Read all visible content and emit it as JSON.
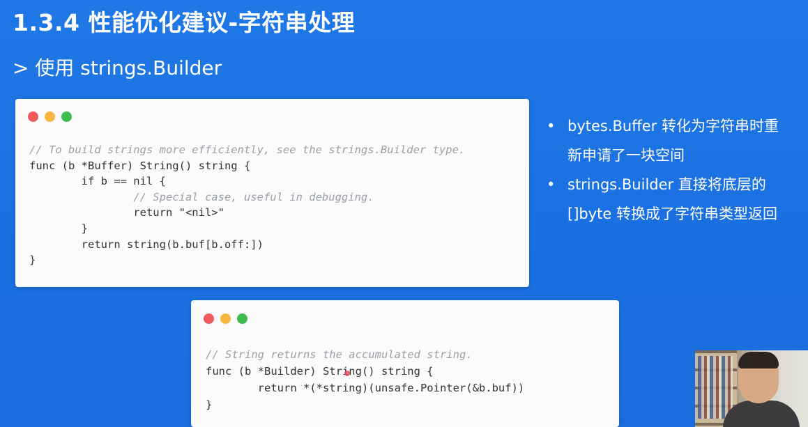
{
  "slide": {
    "title": "1.3.4 性能优化建议-字符串处理",
    "subtitle": "> 使用 strings.Builder"
  },
  "code1": {
    "lines": [
      "// To build strings more efficiently, see the strings.Builder type.",
      "func (b *Buffer) String() string {",
      "        if b == nil {",
      "                // Special case, useful in debugging.",
      "                return \"<nil>\"",
      "        }",
      "        return string(b.buf[b.off:])",
      "}"
    ]
  },
  "code2": {
    "lines": [
      "// String returns the accumulated string.",
      "func (b *Builder) String() string {",
      "        return *(*string)(unsafe.Pointer(&b.buf))",
      "}"
    ]
  },
  "bullets": [
    {
      "line1": "bytes.Buffer 转化为字符串时重",
      "line2": "新申请了一块空间"
    },
    {
      "line1": "strings.Builder 直接将底层的",
      "line2": "[]byte 转换成了字符串类型返回"
    }
  ],
  "bullet_marker": "•",
  "colors": {
    "background": "#1f78e6",
    "card": "#fbfbfc",
    "dot_red": "#f05a5c",
    "dot_yellow": "#f5b73d",
    "dot_green": "#3dbd4d"
  }
}
